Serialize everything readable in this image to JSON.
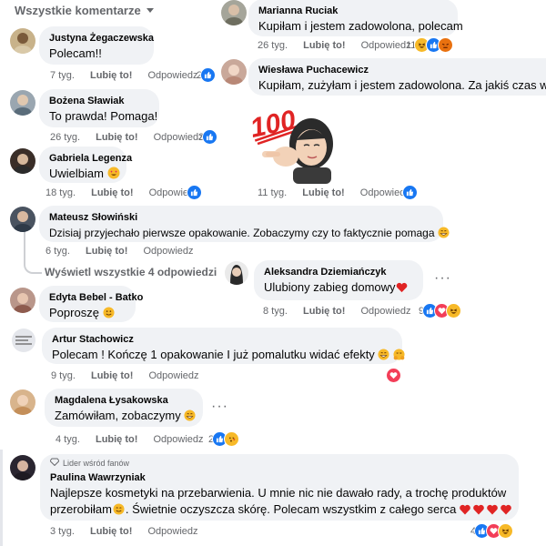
{
  "header": {
    "filter_label": "Wszystkie komentarze"
  },
  "left": {
    "comments": [
      {
        "name": "Justyna Żegaczewska",
        "text": "Polecam!!",
        "time": "7 tyg.",
        "like": "Lubię to!",
        "reply": "Odpowiedz",
        "count": "2"
      },
      {
        "name": "Bożena Sławiak",
        "text": "To prawda! Pomaga!",
        "time": "26 tyg.",
        "like": "Lubię to!",
        "reply": "Odpowiedz",
        "count": "3"
      },
      {
        "name": "Gabriela Legenza",
        "text": "Uwielbiam",
        "time": "18 tyg.",
        "like": "Lubię to!",
        "reply": "Odpowiedz",
        "count": ""
      }
    ]
  },
  "right": {
    "comments": [
      {
        "name": "Marianna Ruciak",
        "text": "Kupiłam i jestem zadowolona, polecam",
        "time": "26 tyg.",
        "like": "Lubię to!",
        "reply": "Odpowiedz",
        "count": "11"
      },
      {
        "name": "Wiesława Puchacewicz",
        "text": "Kupiłam, zużyłam i jestem zadowolona. Za jakiś czas wrócę",
        "time": "",
        "like": "",
        "reply": "",
        "count": ""
      },
      {
        "name": "",
        "text": "",
        "time": "11 tyg.",
        "like": "Lubię to!",
        "reply": "Odpowiedz",
        "count": ""
      }
    ],
    "sticker_text": "100"
  },
  "mateusz": {
    "name": "Mateusz Słowiński",
    "text": "Dzisiaj przyjechało pierwsze opakowanie. Zobaczymy czy to faktycznie pomaga",
    "time": "6 tyg.",
    "like": "Lubię to!",
    "reply": "Odpowiedz",
    "view_replies": "Wyświetl wszystkie 4 odpowiedzi"
  },
  "aleksandra": {
    "name": "Aleksandra Dziemiańczyk",
    "text": "Ulubiony zabieg domowy",
    "time": "8 tyg.",
    "like": "Lubię to!",
    "reply": "Odpowiedz",
    "count": "9"
  },
  "edyta": {
    "name": "Edyta Bebel - Batko",
    "text": "Poproszę"
  },
  "artur": {
    "name": "Artur Stachowicz",
    "text": "Polecam ! Kończę 1 opakowanie I już pomalutku widać efekty",
    "time": "9 tyg.",
    "like": "Lubię to!",
    "reply": "Odpowiedz"
  },
  "magdalena": {
    "name": "Magdalena Łysakowska",
    "text": "Zamówiłam, zobaczymy",
    "time": "4 tyg.",
    "like": "Lubię to!",
    "reply": "Odpowiedz",
    "count": "2"
  },
  "paulina": {
    "badge": "Lider wśród fanów",
    "name": "Paulina Wawrzyniak",
    "line1": "Najlepsze kosmetyki na przebarwienia. U mnie nic nie dawało rady, a trochę produktów",
    "line2": "przerobiłam",
    "line2b": ". Świetnie oczyszcza skórę. Polecam wszystkim z całego serca",
    "time": "3 tyg.",
    "like": "Lubię to!",
    "reply": "Odpowiedz",
    "count": "4"
  },
  "colors": {
    "like": "#1877f2",
    "love": "#f33e58",
    "haha": "#f7b928",
    "bubble": "#f0f2f5",
    "meta": "#65676b"
  }
}
